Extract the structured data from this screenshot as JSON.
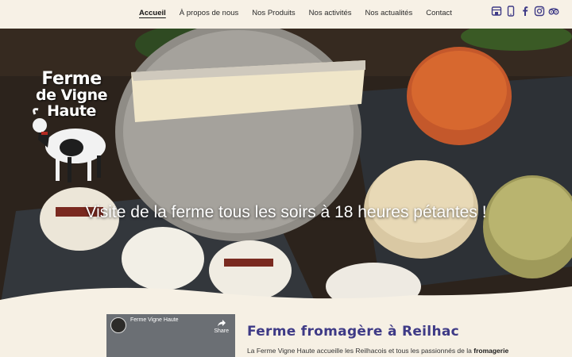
{
  "nav": {
    "items": [
      {
        "label": "Accueil",
        "active": true
      },
      {
        "label": "À propos de nous",
        "active": false
      },
      {
        "label": "Nos Produits",
        "active": false
      },
      {
        "label": "Nos activités",
        "active": false
      },
      {
        "label": "Nos actualités",
        "active": false
      },
      {
        "label": "Contact",
        "active": false
      }
    ]
  },
  "socials": [
    "store-icon",
    "phone-icon",
    "facebook-icon",
    "instagram-icon",
    "tripadvisor-icon"
  ],
  "colors": {
    "accent": "#3e3a86",
    "icon": "#3e3a86",
    "background": "#f6f0e4"
  },
  "hero": {
    "logo_line1": "Ferme",
    "logo_line2": "de Vigne Haute",
    "tagline": "Visite de la ferme tous les soirs à 18 heures pétantes !"
  },
  "video": {
    "title": "Ferme Vigne Haute",
    "share": "Share"
  },
  "section": {
    "title": "Ferme fromagère à Reilhac",
    "text_start": "La Ferme Vigne Haute accueille les Reilhacois et tous les passionnés de la ",
    "text_bold": "fromagerie"
  }
}
